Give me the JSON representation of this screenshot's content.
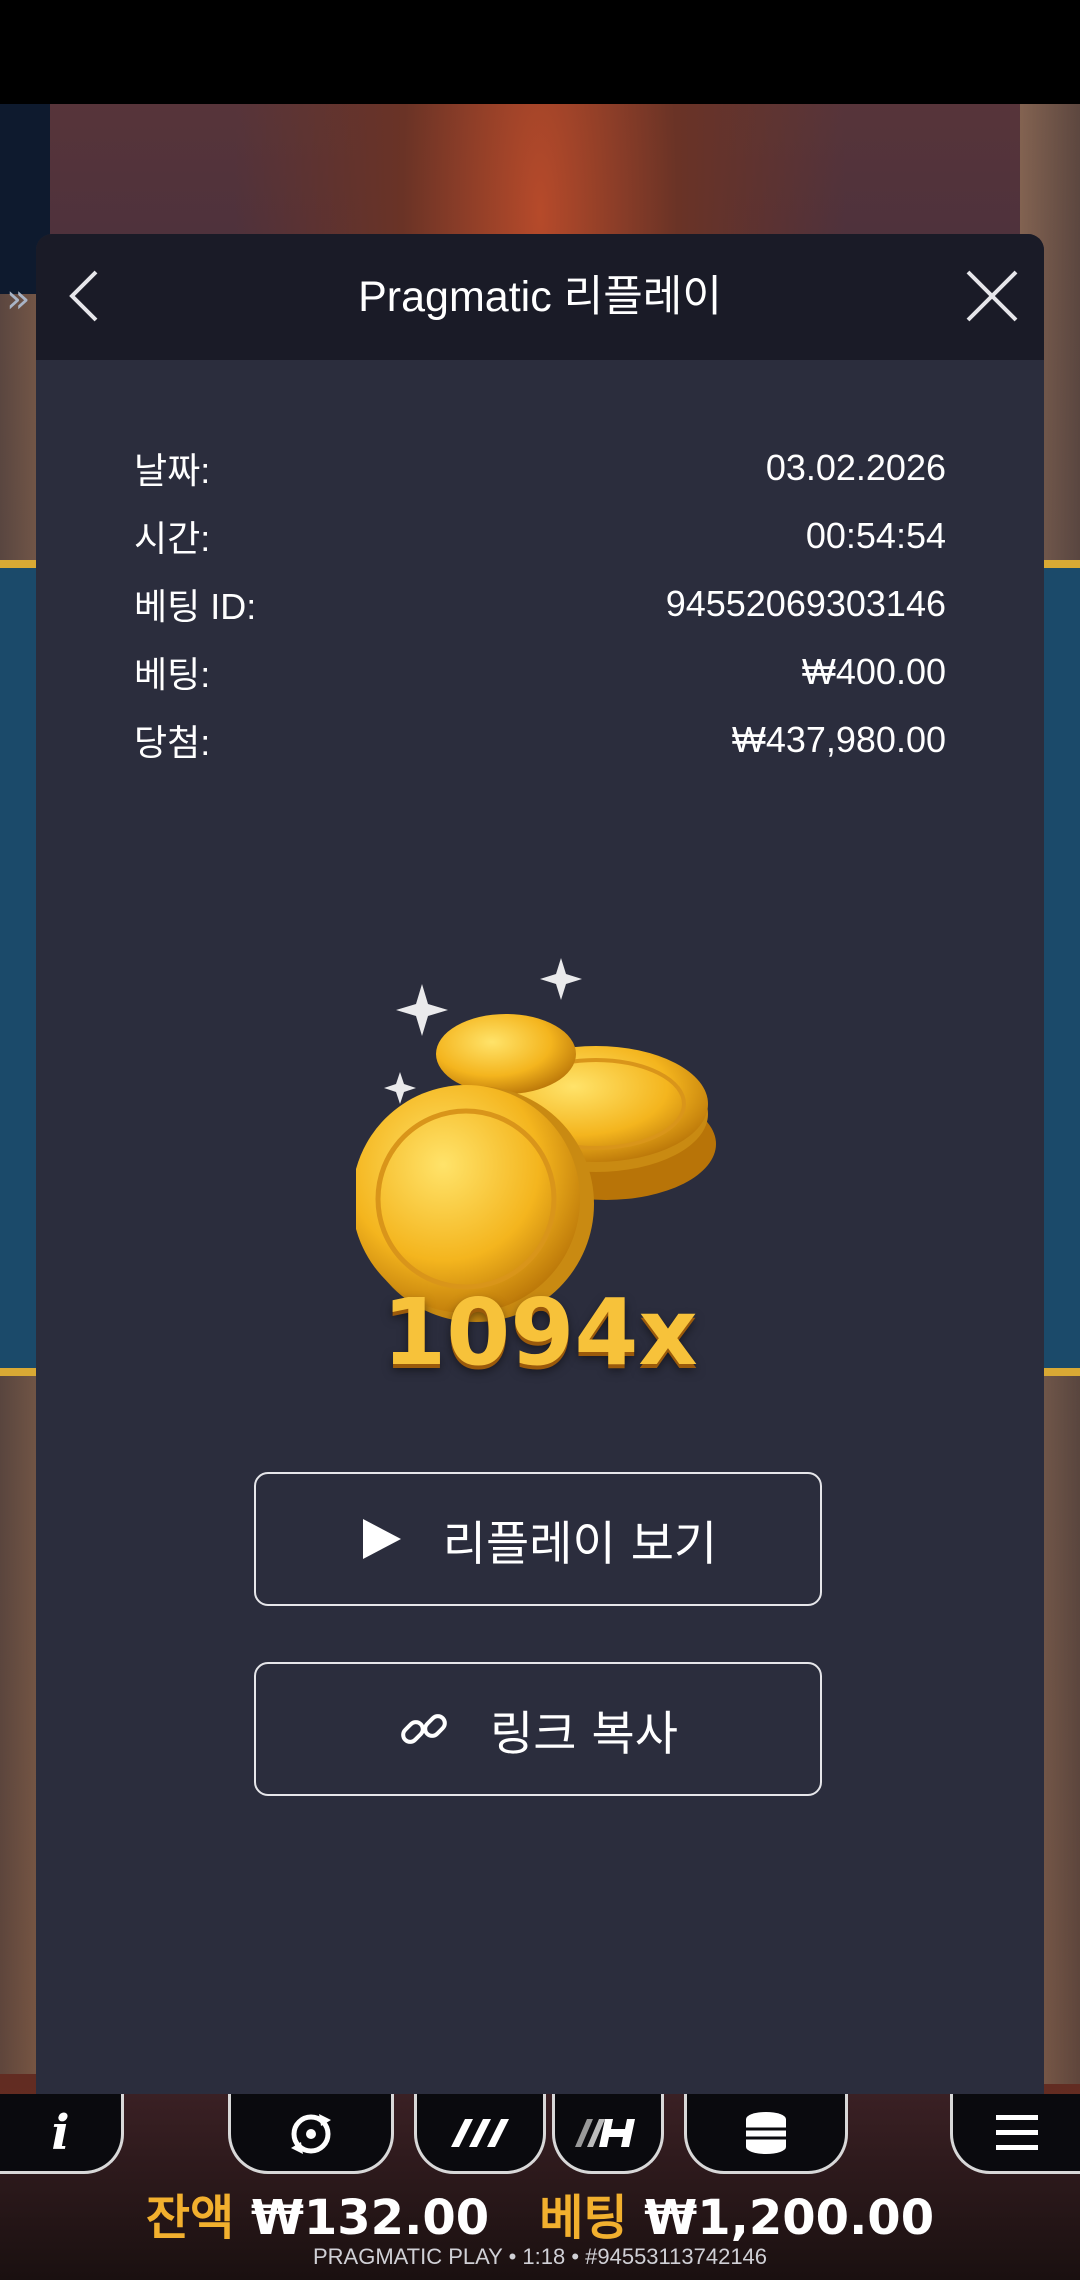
{
  "modal": {
    "title": "Pragmatic 리플레이",
    "info": [
      {
        "label": "날짜:",
        "value": "03.02.2026"
      },
      {
        "label": "시간:",
        "value": "00:54:54"
      },
      {
        "label": "베팅 ID:",
        "value": "94552069303146"
      },
      {
        "label": "베팅:",
        "value": "₩400.00"
      },
      {
        "label": "당첨:",
        "value": "₩437,980.00"
      }
    ],
    "multiplier": "1094x",
    "replay_button": "리플레이 보기",
    "copy_link_button": "링크 복사"
  },
  "game_bar": {
    "balance_label": "잔액",
    "balance_value": "₩132.00",
    "bet_label": "베팅",
    "bet_value": "₩1,200.00",
    "footer": "PRAGMATIC PLAY • 1:18 • #94553113742146"
  },
  "colors": {
    "modal_bg": "#2b2d3d",
    "header_bg": "#1a1b27",
    "gold": "#f2b02e"
  }
}
